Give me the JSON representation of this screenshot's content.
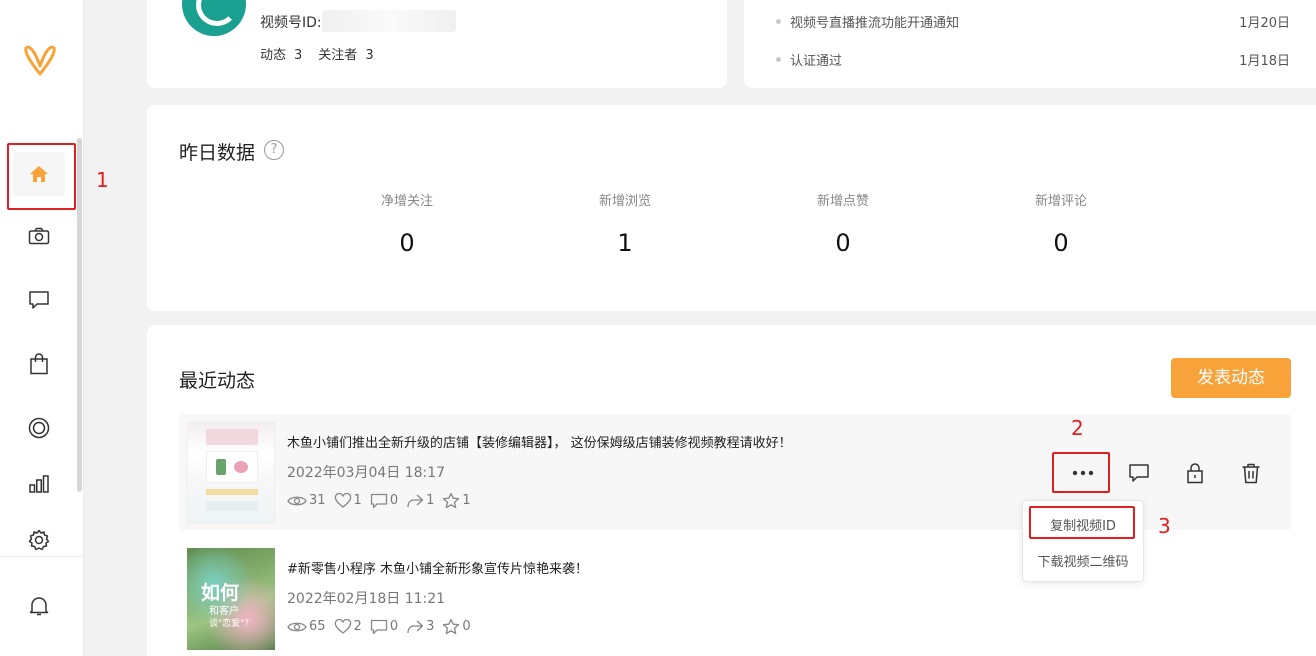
{
  "profile": {
    "id_label": "视频号ID:",
    "stats": [
      "动态",
      "3",
      "关注者",
      "3"
    ]
  },
  "notices": [
    {
      "text": "视频号直播推流功能开通通知",
      "date": "1月20日"
    },
    {
      "text": "认证通过",
      "date": "1月18日"
    }
  ],
  "yesterday": {
    "title": "昨日数据",
    "help": "?",
    "stats": [
      {
        "label": "净增关注",
        "value": "0"
      },
      {
        "label": "新增浏览",
        "value": "1"
      },
      {
        "label": "新增点赞",
        "value": "0"
      },
      {
        "label": "新增评论",
        "value": "0"
      }
    ]
  },
  "recent": {
    "title": "最近动态",
    "publish_label": "发表动态",
    "posts": [
      {
        "title": "木鱼小铺们推出全新升级的店铺【装修编辑器】， 这份保姆级店铺装修视频教程请收好！",
        "time": "2022年03月04日 18:17",
        "views": "31",
        "likes": "1",
        "comments": "0",
        "shares": "1",
        "favs": "1"
      },
      {
        "title": "#新零售小程序 木鱼小铺全新形象宣传片惊艳来袭！",
        "time": "2022年02月18日 11:21",
        "views": "65",
        "likes": "2",
        "comments": "0",
        "shares": "3",
        "favs": "0",
        "thumb_text": [
          "如何",
          "和客户",
          "谈\"恋爱\"?"
        ]
      }
    ]
  },
  "dropdown": {
    "items": [
      "复制视频ID",
      "下载视频二维码"
    ]
  },
  "annotations": [
    "1",
    "2",
    "3"
  ],
  "colors": {
    "accent": "#f8a23a",
    "annotation_red": "#e02020"
  },
  "icons": [
    "logo-icon",
    "home-icon",
    "camera-icon",
    "message-icon",
    "bag-icon",
    "target-icon",
    "chart-icon",
    "gear-icon",
    "bell-icon",
    "more-icon",
    "comment-icon",
    "lock-icon",
    "trash-icon"
  ]
}
